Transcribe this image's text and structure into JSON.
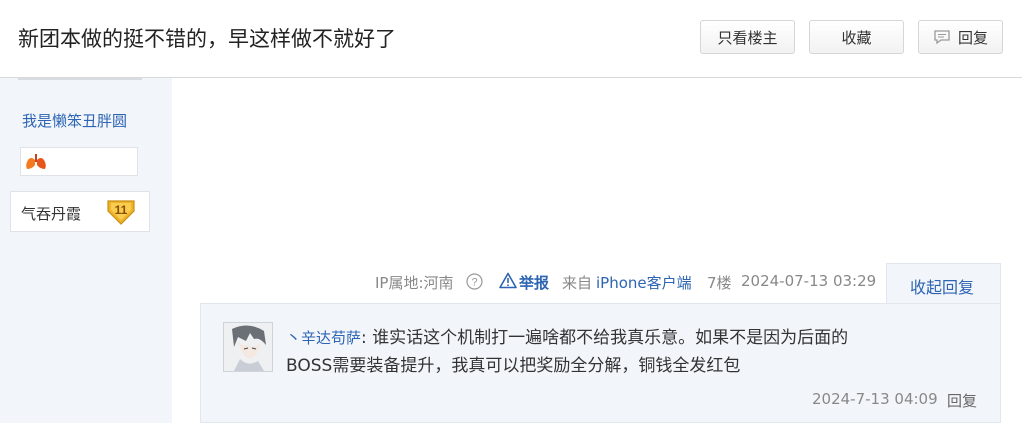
{
  "header": {
    "thread_title": "新团本做的挺不错的，早这样做不就好了",
    "only_author_label": "只看楼主",
    "favorite_label": "收藏",
    "reply_label": "回复"
  },
  "sidebar": {
    "username": "我是懒笨丑胖圆",
    "badge_icon": "lung-icon",
    "level_name": "气吞丹霞",
    "level_number": "11"
  },
  "post_meta": {
    "ip_location": "IP属地:河南",
    "report_label": "举报",
    "from_label": "来自",
    "device_label": "iPhone客户端",
    "floor": "7楼",
    "timestamp": "2024-07-13 03:29",
    "collapse_reply_label": "收起回复"
  },
  "comment": {
    "author": "丶辛达苟萨",
    "separator": ":",
    "text_line1": "谁实话这个机制打一遍啥都不给我真乐意。如果不是因为后面的",
    "text_line2": "BOSS需要装备提升，我真可以把奖励全分解，铜钱全发红包",
    "timestamp": "2024-7-13 04:09",
    "reply_label": "回复"
  },
  "colors": {
    "link_blue": "#2d64b3",
    "sidebar_bg": "#f2f6fb",
    "badge_gold": "#f0b429"
  }
}
